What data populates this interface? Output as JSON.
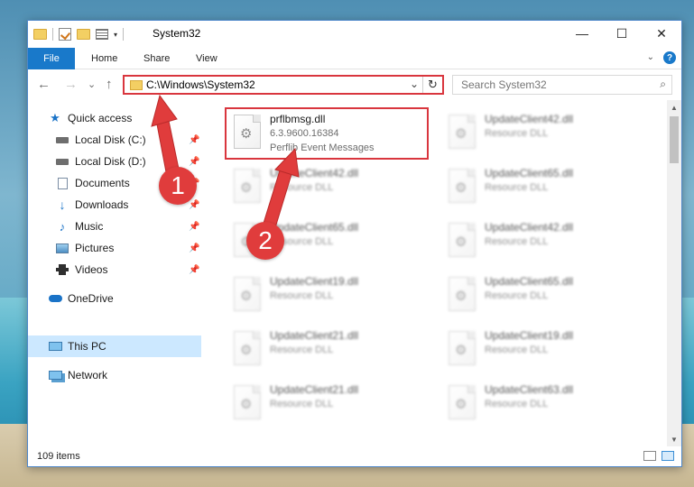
{
  "window": {
    "title": "System32"
  },
  "window_controls": {
    "minimize": "—",
    "maximize": "☐",
    "close": "✕"
  },
  "ribbon": {
    "file": "File",
    "tabs": [
      "Home",
      "Share",
      "View"
    ],
    "help": "?"
  },
  "navigation": {
    "back": "←",
    "forward": "→",
    "recent": "⌄",
    "up": "↑"
  },
  "address": {
    "path": "C:\\Windows\\System32"
  },
  "search": {
    "placeholder": "Search System32"
  },
  "sidebar": {
    "items": [
      {
        "label": "Quick access",
        "icon": "star-icon",
        "pinned": false
      },
      {
        "label": "Local Disk (C:)",
        "icon": "drive-icon",
        "pinned": true
      },
      {
        "label": "Local Disk (D:)",
        "icon": "drive-icon",
        "pinned": true
      },
      {
        "label": "Documents",
        "icon": "documents-icon",
        "pinned": true
      },
      {
        "label": "Downloads",
        "icon": "downloads-icon",
        "pinned": true
      },
      {
        "label": "Music",
        "icon": "music-icon",
        "pinned": true
      },
      {
        "label": "Pictures",
        "icon": "pictures-icon",
        "pinned": true
      },
      {
        "label": "Videos",
        "icon": "videos-icon",
        "pinned": true
      },
      {
        "label": "OneDrive",
        "icon": "cloud-icon",
        "pinned": false
      },
      {
        "label": "This PC",
        "icon": "computer-icon",
        "pinned": false,
        "selected": true
      },
      {
        "label": "Network",
        "icon": "network-icon",
        "pinned": false
      }
    ]
  },
  "files": [
    {
      "name": "prflbmsg.dll",
      "version": "6.3.9600.16384",
      "description": "Perflib Event Messages"
    },
    {
      "name": "UpdateClient42.dll",
      "description": "Resource DLL"
    },
    {
      "name": "UpdateClient42.dll",
      "description": "Resource DLL"
    },
    {
      "name": "UpdateClient65.dll",
      "description": "Resource DLL"
    },
    {
      "name": "UpdateClient65.dll",
      "description": "Resource DLL"
    },
    {
      "name": "UpdateClient42.dll",
      "description": "Resource DLL"
    },
    {
      "name": "UpdateClient19.dll",
      "description": "Resource DLL"
    },
    {
      "name": "UpdateClient65.dll",
      "description": "Resource DLL"
    },
    {
      "name": "UpdateClient21.dll",
      "description": "Resource DLL"
    },
    {
      "name": "UpdateClient19.dll",
      "description": "Resource DLL"
    },
    {
      "name": "UpdateClient21.dll",
      "description": "Resource DLL"
    },
    {
      "name": "UpdateClient63.dll",
      "description": "Resource DLL"
    }
  ],
  "status": {
    "item_count": "109 items"
  },
  "annotations": {
    "marker1": "1",
    "marker2": "2",
    "color": "#e03c3c"
  }
}
